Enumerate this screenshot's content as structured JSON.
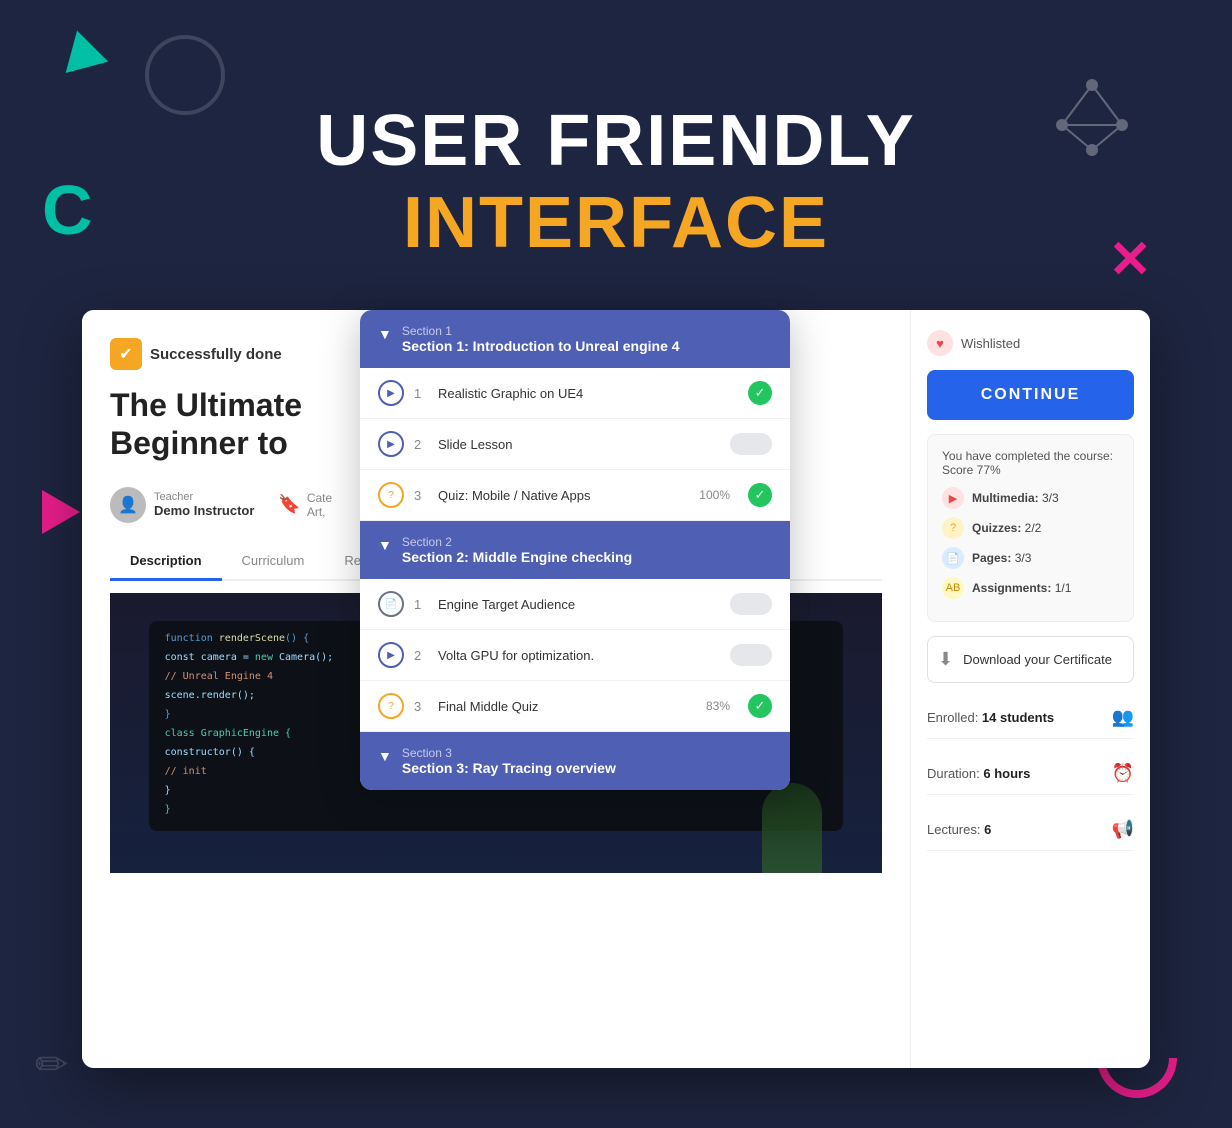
{
  "hero": {
    "line1": "USER FRIENDLY",
    "line2": "INTERFACE"
  },
  "left": {
    "success_badge": "Successfully done",
    "course_title": "The Ultimate\nBeginner to",
    "instructor_label": "Teacher",
    "instructor_name": "Demo Instructor",
    "category_label": "Cate",
    "category_value": "Art,",
    "tabs": [
      "Description",
      "Curriculum",
      "Reviews"
    ]
  },
  "dropdown": {
    "section1_label": "Section 1",
    "section1_title": "Section 1: Introduction to Unreal engine 4",
    "lessons1": [
      {
        "num": "1",
        "name": "Realistic Graphic on UE4",
        "type": "video",
        "completed": true
      },
      {
        "num": "2",
        "name": "Slide Lesson",
        "type": "video",
        "completed": false
      },
      {
        "num": "3",
        "name": "Quiz: Mobile / Native Apps",
        "type": "quiz",
        "score": "100%",
        "completed": true
      }
    ],
    "section2_label": "Section 2",
    "section2_title": "Section 2: Middle Engine checking",
    "lessons2": [
      {
        "num": "1",
        "name": "Engine Target Audience",
        "type": "page",
        "completed": false
      },
      {
        "num": "2",
        "name": "Volta GPU for optimization.",
        "type": "video",
        "completed": false
      },
      {
        "num": "3",
        "name": "Final Middle Quiz",
        "type": "quiz",
        "score": "83%",
        "completed": true
      }
    ],
    "section3_label": "Section 3",
    "section3_title": "Section 3: Ray Tracing overview"
  },
  "right": {
    "wishlist_text": "Wishlisted",
    "continue_btn": "CONTINUE",
    "completion_text": "You have completed the course: Score 77%",
    "stats": [
      {
        "label": "Multimedia: 3/3",
        "type": "red"
      },
      {
        "label": "Quizzes: 2/2",
        "type": "orange"
      },
      {
        "label": "Pages: 3/3",
        "type": "blue"
      },
      {
        "label": "Assignments: 1/1",
        "type": "yellow"
      }
    ],
    "cert_btn": "Download your Certificate",
    "enrolled_label": "Enrolled:",
    "enrolled_value": "14 students",
    "duration_label": "Duration:",
    "duration_value": "6 hours",
    "lectures_label": "Lectures:",
    "lectures_value": "6"
  }
}
